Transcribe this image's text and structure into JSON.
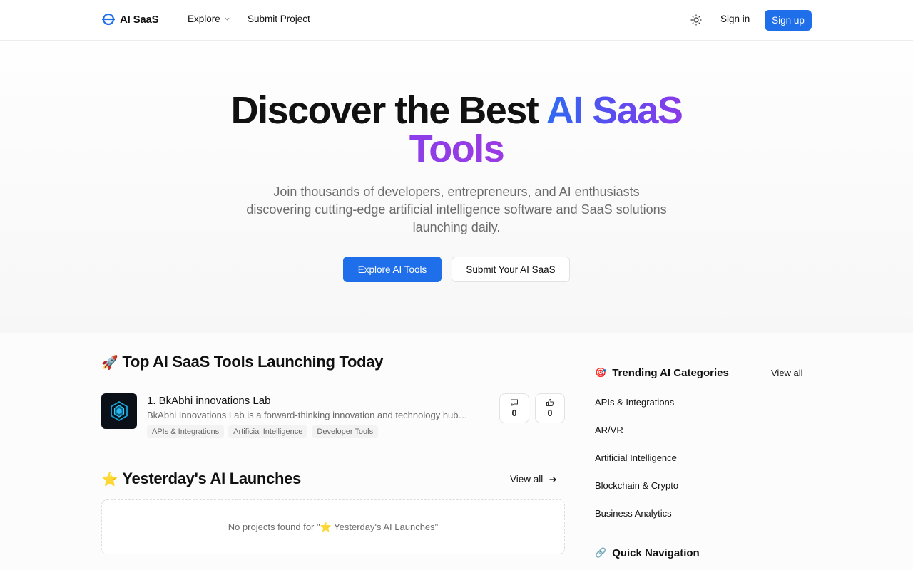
{
  "header": {
    "brand": "AI SaaS",
    "nav": {
      "explore": "Explore",
      "submit": "Submit Project"
    },
    "signin": "Sign in",
    "signup": "Sign up"
  },
  "hero": {
    "title_part1": "Discover the Best ",
    "title_highlight": "AI SaaS",
    "title_line2": "Tools",
    "subtitle": "Join thousands of developers, entrepreneurs, and AI enthusiasts discovering cutting-edge artificial intelligence software and SaaS solutions launching daily.",
    "primary_button": "Explore AI Tools",
    "secondary_button": "Submit Your AI SaaS"
  },
  "today": {
    "emoji": "🚀",
    "title": "Top AI SaaS Tools Launching Today",
    "products": [
      {
        "name": "1. BkAbhi innovations Lab",
        "description": "BkAbhi Innovations Lab is a forward-thinking innovation and technology hub…",
        "tags": [
          "APIs & Integrations",
          "Artificial Intelligence",
          "Developer Tools"
        ],
        "comments": "0",
        "upvotes": "0"
      }
    ]
  },
  "yesterday": {
    "emoji": "⭐",
    "title": "Yesterday's AI Launches",
    "view_all": "View all",
    "empty_message": "No projects found for \"⭐  Yesterday's AI Launches\""
  },
  "sidebar": {
    "trending": {
      "emoji": "🎯",
      "title": "Trending AI Categories",
      "view_all": "View all",
      "items": [
        "APIs & Integrations",
        "AR/VR",
        "Artificial Intelligence",
        "Blockchain & Crypto",
        "Business Analytics"
      ]
    },
    "quick_nav": {
      "emoji": "🔗",
      "title": "Quick Navigation"
    }
  },
  "colors": {
    "accent": "#1f6feb",
    "gradient_start": "#2f6bf2",
    "gradient_end": "#9b3ae4"
  }
}
